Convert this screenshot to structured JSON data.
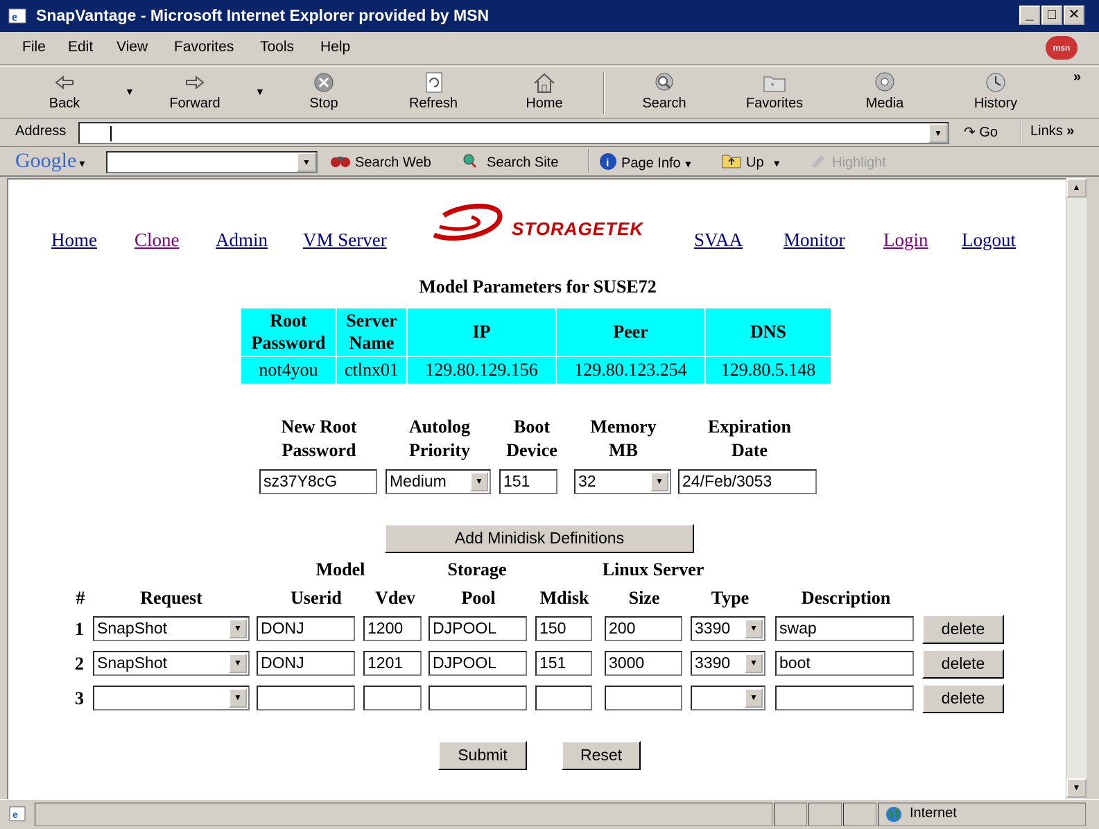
{
  "window": {
    "title": "SnapVantage - Microsoft Internet Explorer provided by MSN"
  },
  "menu": [
    "File",
    "Edit",
    "View",
    "Favorites",
    "Tools",
    "Help"
  ],
  "toolbar": {
    "back": "Back",
    "forward": "Forward",
    "stop": "Stop",
    "refresh": "Refresh",
    "home": "Home",
    "search": "Search",
    "favorites": "Favorites",
    "media": "Media",
    "history": "History"
  },
  "address": {
    "label": "Address",
    "value": "",
    "go": "Go",
    "links": "Links"
  },
  "google": {
    "logo": "Google",
    "search_web": "Search Web",
    "search_site": "Search Site",
    "page_info": "Page Info",
    "up": "Up",
    "highlight": "Highlight"
  },
  "nav": {
    "home": "Home",
    "clone": "Clone",
    "admin": "Admin",
    "vm_server": "VM Server",
    "brand": "STORAGETEK",
    "svaa": "SVAA",
    "monitor": "Monitor",
    "login": "Login",
    "logout": "Logout"
  },
  "page": {
    "heading": "Model Parameters for SUSE72"
  },
  "params": {
    "headers": {
      "root_password_1": "Root",
      "root_password_2": "Password",
      "server_name_1": "Server",
      "server_name_2": "Name",
      "ip": "IP",
      "peer": "Peer",
      "dns": "DNS"
    },
    "values": {
      "root_password": "not4you",
      "server_name": "ctlnx01",
      "ip": "129.80.129.156",
      "peer": "129.80.123.254",
      "dns": "129.80.5.148"
    }
  },
  "settings": {
    "headers": {
      "new_root_1": "New Root",
      "new_root_2": "Password",
      "autolog_1": "Autolog",
      "autolog_2": "Priority",
      "boot_1": "Boot",
      "boot_2": "Device",
      "memory_1": "Memory",
      "memory_2": "MB",
      "expiration_1": "Expiration",
      "expiration_2": "Date"
    },
    "values": {
      "new_root_password": "sz37Y8cG",
      "autolog_priority": "Medium",
      "boot_device": "151",
      "memory_mb": "32",
      "expiration_date": "24/Feb/3053"
    }
  },
  "add_minidisk": "Add Minidisk Definitions",
  "minidisks": {
    "group_headers": {
      "model": "Model",
      "storage": "Storage",
      "linux_server": "Linux Server"
    },
    "headers": {
      "num": "#",
      "request": "Request",
      "userid": "Userid",
      "vdev": "Vdev",
      "pool": "Pool",
      "mdisk": "Mdisk",
      "size": "Size",
      "type": "Type",
      "description": "Description"
    },
    "delete_label": "delete",
    "rows": [
      {
        "num": "1",
        "request": "SnapShot",
        "userid": "DONJ",
        "vdev": "1200",
        "pool": "DJPOOL",
        "mdisk": "150",
        "size": "200",
        "type": "3390",
        "description": "swap"
      },
      {
        "num": "2",
        "request": "SnapShot",
        "userid": "DONJ",
        "vdev": "1201",
        "pool": "DJPOOL",
        "mdisk": "151",
        "size": "3000",
        "type": "3390",
        "description": "boot"
      },
      {
        "num": "3",
        "request": "",
        "userid": "",
        "vdev": "",
        "pool": "",
        "mdisk": "",
        "size": "",
        "type": "",
        "description": ""
      }
    ]
  },
  "form": {
    "submit": "Submit",
    "reset": "Reset"
  },
  "status": {
    "zone": "Internet"
  }
}
